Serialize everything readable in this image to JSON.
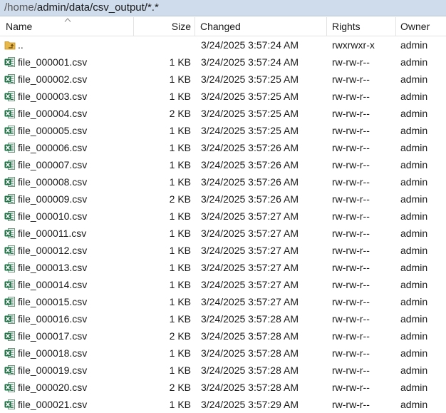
{
  "path": {
    "prefix": "/home/",
    "rest": "admin/data/csv_output/*.*"
  },
  "columns": {
    "name": "Name",
    "size": "Size",
    "changed": "Changed",
    "rights": "Rights",
    "owner": "Owner"
  },
  "colors": {
    "pathbar_bg": "#cfdcec",
    "excel_green": "#1e7145",
    "folder_yellow": "#e9b84a"
  },
  "rows": [
    {
      "icon": "parent-folder-icon",
      "name": "..",
      "size": "",
      "changed": "3/24/2025 3:57:24 AM",
      "rights": "rwxrwxr-x",
      "owner": "admin"
    },
    {
      "icon": "excel-file-icon",
      "name": "file_000001.csv",
      "size": "1 KB",
      "changed": "3/24/2025 3:57:24 AM",
      "rights": "rw-rw-r--",
      "owner": "admin"
    },
    {
      "icon": "excel-file-icon",
      "name": "file_000002.csv",
      "size": "1 KB",
      "changed": "3/24/2025 3:57:25 AM",
      "rights": "rw-rw-r--",
      "owner": "admin"
    },
    {
      "icon": "excel-file-icon",
      "name": "file_000003.csv",
      "size": "1 KB",
      "changed": "3/24/2025 3:57:25 AM",
      "rights": "rw-rw-r--",
      "owner": "admin"
    },
    {
      "icon": "excel-file-icon",
      "name": "file_000004.csv",
      "size": "2 KB",
      "changed": "3/24/2025 3:57:25 AM",
      "rights": "rw-rw-r--",
      "owner": "admin"
    },
    {
      "icon": "excel-file-icon",
      "name": "file_000005.csv",
      "size": "1 KB",
      "changed": "3/24/2025 3:57:25 AM",
      "rights": "rw-rw-r--",
      "owner": "admin"
    },
    {
      "icon": "excel-file-icon",
      "name": "file_000006.csv",
      "size": "1 KB",
      "changed": "3/24/2025 3:57:26 AM",
      "rights": "rw-rw-r--",
      "owner": "admin"
    },
    {
      "icon": "excel-file-icon",
      "name": "file_000007.csv",
      "size": "1 KB",
      "changed": "3/24/2025 3:57:26 AM",
      "rights": "rw-rw-r--",
      "owner": "admin"
    },
    {
      "icon": "excel-file-icon",
      "name": "file_000008.csv",
      "size": "1 KB",
      "changed": "3/24/2025 3:57:26 AM",
      "rights": "rw-rw-r--",
      "owner": "admin"
    },
    {
      "icon": "excel-file-icon",
      "name": "file_000009.csv",
      "size": "2 KB",
      "changed": "3/24/2025 3:57:26 AM",
      "rights": "rw-rw-r--",
      "owner": "admin"
    },
    {
      "icon": "excel-file-icon",
      "name": "file_000010.csv",
      "size": "1 KB",
      "changed": "3/24/2025 3:57:27 AM",
      "rights": "rw-rw-r--",
      "owner": "admin"
    },
    {
      "icon": "excel-file-icon",
      "name": "file_000011.csv",
      "size": "1 KB",
      "changed": "3/24/2025 3:57:27 AM",
      "rights": "rw-rw-r--",
      "owner": "admin"
    },
    {
      "icon": "excel-file-icon",
      "name": "file_000012.csv",
      "size": "1 KB",
      "changed": "3/24/2025 3:57:27 AM",
      "rights": "rw-rw-r--",
      "owner": "admin"
    },
    {
      "icon": "excel-file-icon",
      "name": "file_000013.csv",
      "size": "1 KB",
      "changed": "3/24/2025 3:57:27 AM",
      "rights": "rw-rw-r--",
      "owner": "admin"
    },
    {
      "icon": "excel-file-icon",
      "name": "file_000014.csv",
      "size": "1 KB",
      "changed": "3/24/2025 3:57:27 AM",
      "rights": "rw-rw-r--",
      "owner": "admin"
    },
    {
      "icon": "excel-file-icon",
      "name": "file_000015.csv",
      "size": "1 KB",
      "changed": "3/24/2025 3:57:27 AM",
      "rights": "rw-rw-r--",
      "owner": "admin"
    },
    {
      "icon": "excel-file-icon",
      "name": "file_000016.csv",
      "size": "1 KB",
      "changed": "3/24/2025 3:57:28 AM",
      "rights": "rw-rw-r--",
      "owner": "admin"
    },
    {
      "icon": "excel-file-icon",
      "name": "file_000017.csv",
      "size": "2 KB",
      "changed": "3/24/2025 3:57:28 AM",
      "rights": "rw-rw-r--",
      "owner": "admin"
    },
    {
      "icon": "excel-file-icon",
      "name": "file_000018.csv",
      "size": "1 KB",
      "changed": "3/24/2025 3:57:28 AM",
      "rights": "rw-rw-r--",
      "owner": "admin"
    },
    {
      "icon": "excel-file-icon",
      "name": "file_000019.csv",
      "size": "1 KB",
      "changed": "3/24/2025 3:57:28 AM",
      "rights": "rw-rw-r--",
      "owner": "admin"
    },
    {
      "icon": "excel-file-icon",
      "name": "file_000020.csv",
      "size": "2 KB",
      "changed": "3/24/2025 3:57:28 AM",
      "rights": "rw-rw-r--",
      "owner": "admin"
    },
    {
      "icon": "excel-file-icon",
      "name": "file_000021.csv",
      "size": "1 KB",
      "changed": "3/24/2025 3:57:29 AM",
      "rights": "rw-rw-r--",
      "owner": "admin"
    }
  ]
}
